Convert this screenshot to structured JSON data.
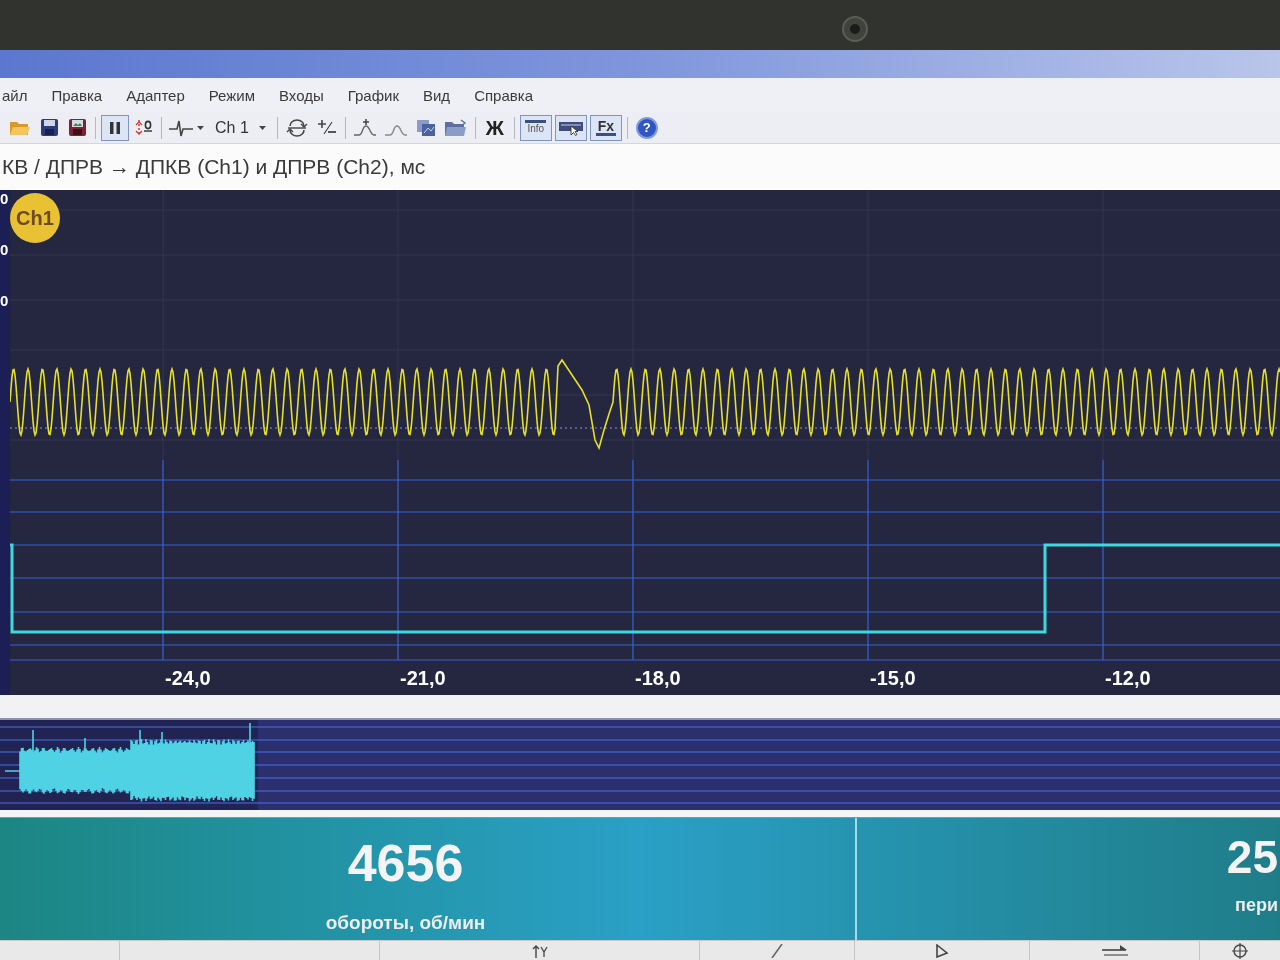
{
  "menu": [
    "айл",
    "Правка",
    "Адаптер",
    "Режим",
    "Входы",
    "График",
    "Вид",
    "Справка"
  ],
  "toolbar": {
    "pause": {
      "pressed": true
    },
    "channel": "Ch 1",
    "letter_button": "Ж",
    "info": {
      "label": "Info",
      "pressed": true
    },
    "display": {
      "pressed": true
    },
    "fx": {
      "label": "Fx",
      "pressed": true
    },
    "help": "?"
  },
  "chart_title": "КВ / ДПРВ → ДПКВ (Ch1) и ДПРВ (Ch2), мс",
  "y_axis_labels": [
    "0",
    "0",
    "0"
  ],
  "channel_badge": "Ch1",
  "x_axis_labels": [
    "-24,0",
    "-21,0",
    "-18,0",
    "-15,0",
    "-12,0"
  ],
  "readings": [
    {
      "value": "4656",
      "label": "обороты, об/мин"
    },
    {
      "value": "25",
      "label": "пери"
    }
  ]
}
